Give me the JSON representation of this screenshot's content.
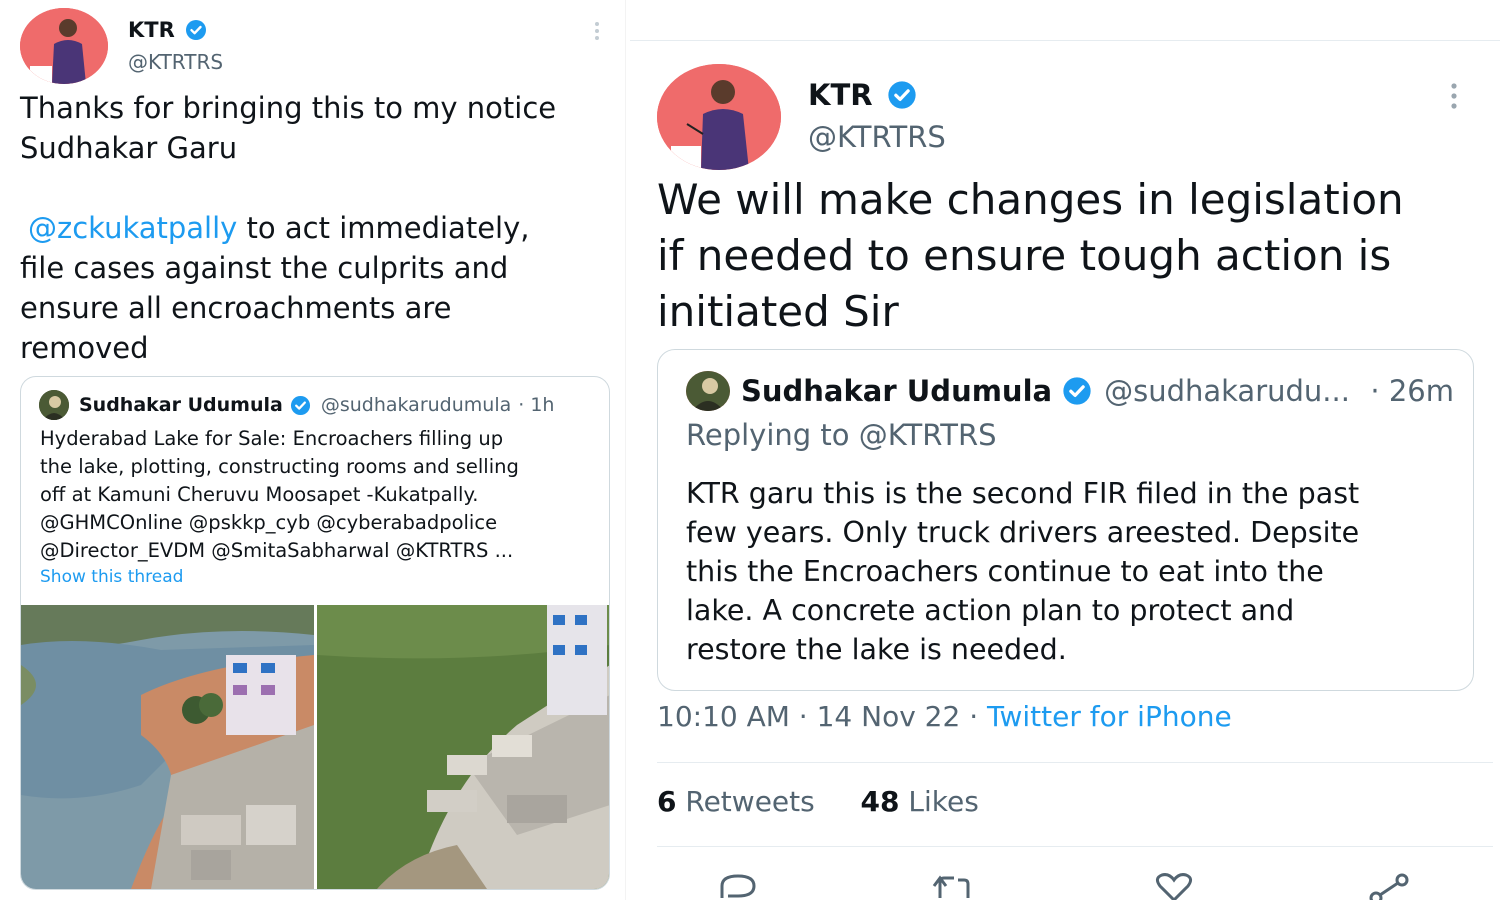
{
  "left_tweet": {
    "author_name": "KTR",
    "author_handle": "@KTRTRS",
    "text_line1": "Thanks for bringing this to my notice\nSudhakar Garu",
    "mention": "@zckukatpally",
    "text_rest": " to act immediately,\nfile cases against the culprits and\nensure all encroachments are\nremoved",
    "quoted": {
      "author_name": "Sudhakar Udumula",
      "author_handle": "@sudhakarudumula",
      "time": "· 1h",
      "text": "Hyderabad Lake for Sale: Encroachers filling up\nthe lake, plotting, constructing rooms and selling\noff at Kamuni Cheruvu Moosapet -Kukatpally.\n@GHMCOnline @pskkp_cyb @cyberabadpolice\n@Director_EVDM @SmitaSabharwal @KTRTRS ...",
      "show_thread": "Show this thread"
    }
  },
  "right_tweet": {
    "author_name": "KTR",
    "author_handle": "@KTRTRS",
    "text": "We will make changes in legislation\nif needed to ensure tough action is\ninitiated Sir",
    "replied_tweet": {
      "author_name": "Sudhakar Udumula",
      "author_handle": "@sudhakarudu...",
      "time": "· 26m",
      "replying_to_label": "Replying to ",
      "replying_to_handle": "@KTRTRS",
      "text": "KTR garu this is the second FIR filed in the past\nfew years. Only truck drivers areested.  Depsite\nthis the Encroachers continue to eat into the\nlake. A concrete action plan to protect and\nrestore the lake is needed."
    },
    "time": "10:10 AM · 14 Nov 22 · ",
    "source": "Twitter for iPhone",
    "retweets_count": "6",
    "retweets_label": " Retweets",
    "likes_count": "48",
    "likes_label": " Likes"
  },
  "colors": {
    "link": "#1d9bf0",
    "verified": "#1d9bf0",
    "secondary_text": "#536471",
    "border": "#cfd9de"
  },
  "icons": [
    "more-dots-icon",
    "verified-badge-icon",
    "reply-icon",
    "retweet-icon",
    "like-icon",
    "share-icon"
  ]
}
